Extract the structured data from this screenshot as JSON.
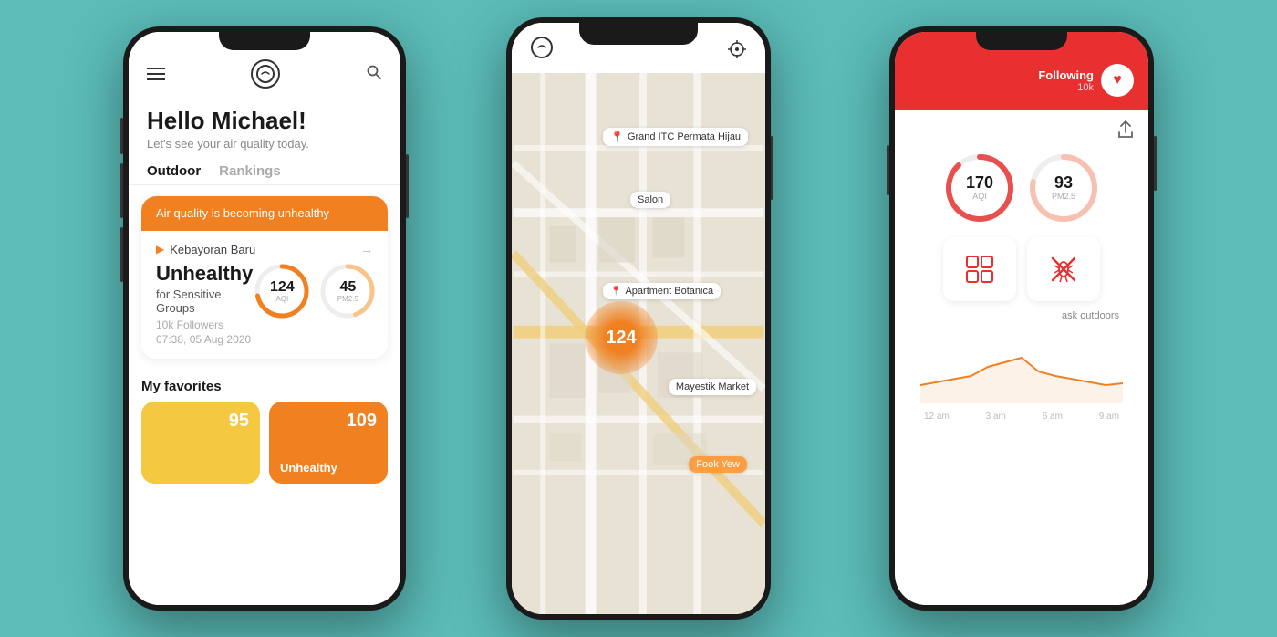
{
  "background": "#5bbcb8",
  "phone_left": {
    "topbar": {
      "logo_symbol": "n",
      "search_symbol": "🔍"
    },
    "greeting": {
      "hello": "Hello Michael!",
      "subtitle": "Let's see your air quality today."
    },
    "tabs": [
      {
        "label": "Outdoor",
        "active": true
      },
      {
        "label": "Rankings",
        "active": false
      }
    ],
    "aq_card": {
      "header": "Air quality is becoming unhealthy",
      "location": "Kebayoran Baru",
      "status": "Unhealthy",
      "status_sub": "for Sensitive Groups",
      "followers": "10k Followers",
      "datetime": "07:38, 05 Aug 2020",
      "aqi_value": "124",
      "aqi_label": "AQI",
      "pm25_value": "45",
      "pm25_label": "PM2.5",
      "aqi_percent": 0.72,
      "pm25_percent": 0.45
    },
    "favorites": {
      "title": "My favorites",
      "cards": [
        {
          "value": "95",
          "color": "yellow"
        },
        {
          "label": "Unhealthy",
          "value": "109",
          "color": "orange"
        }
      ]
    }
  },
  "phone_mid": {
    "map": {
      "location_label": "Grand ITC Permata Hijau",
      "salon_label": "Salon",
      "botanica_label": "Apartment Botanica",
      "mayestik_label": "Mayestik Market",
      "fook_label": "Fook Yew",
      "marker_value": "124"
    }
  },
  "phone_right": {
    "header": {
      "following_label": "Following",
      "following_count": "10k"
    },
    "metrics": {
      "aqi_value": "170",
      "aqi_label": "AQI",
      "pm25_value": "93",
      "pm25_label": "PM2.5",
      "aqi_percent": 0.88,
      "pm25_percent": 0.78
    },
    "mask_text": "ask outdoors",
    "chart_labels": [
      "12 am",
      "3 am",
      "6 am",
      "9 am"
    ]
  },
  "icons": {
    "hamburger": "☰",
    "search": "⌕",
    "location_arrow": "➤",
    "chevron_right": "→",
    "share": "⬆",
    "heart": "♥",
    "crosshair": "⊕",
    "windows": "⊞",
    "mosquito": "✕"
  }
}
